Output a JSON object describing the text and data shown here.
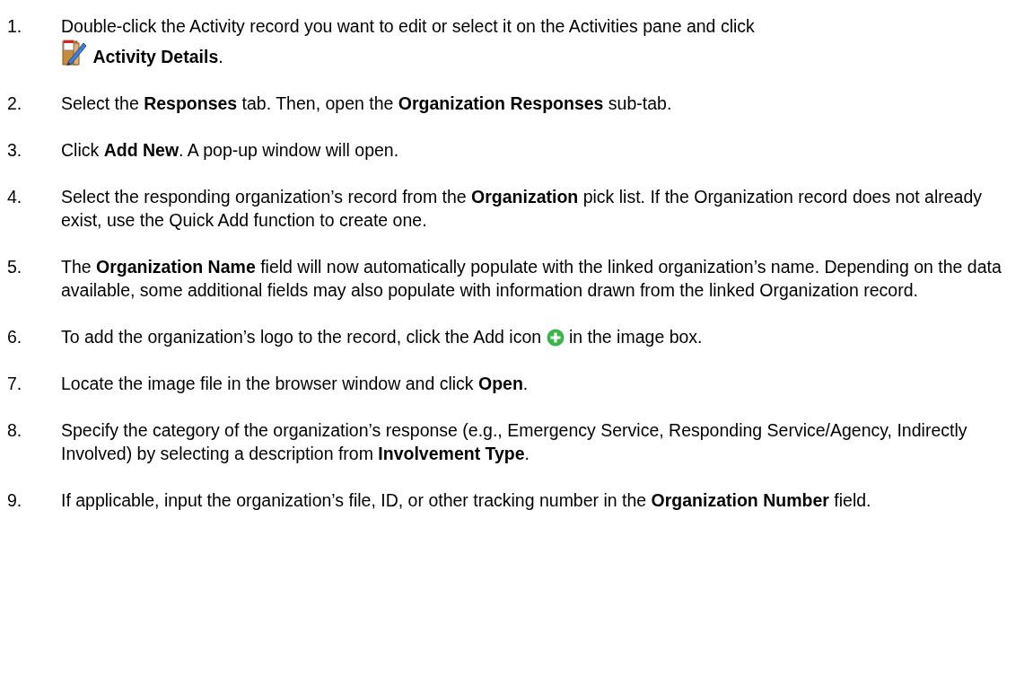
{
  "steps": [
    {
      "number": "1.",
      "kind": "details_icon",
      "before": "Double-click the Activity record you want to edit or select it on the Activities pane and click",
      "after": "**Activity Details**."
    },
    {
      "number": "2.",
      "kind": "plain",
      "before": "Select the **Responses** tab. Then, open the **Organization Responses** sub-tab."
    },
    {
      "number": "3.",
      "kind": "plain",
      "before": "Click **Add New**. A pop-up window will open."
    },
    {
      "number": "4.",
      "kind": "plain",
      "before": "Select the responding organization’s record from the **Organization** pick list. If the Organization record does not already exist, use the Quick Add function to create one."
    },
    {
      "number": "5.",
      "kind": "plain",
      "before": "The **Organization Name** field will now automatically populate with the linked organization’s name. Depending on the data available, some additional fields may also populate with information drawn from the linked Organization record."
    },
    {
      "number": "6.",
      "kind": "add_icon",
      "before": "To add the organization’s logo to the record, click the Add icon",
      "after": "in the image box."
    },
    {
      "number": "7.",
      "kind": "plain",
      "before": "Locate the image file in the browser window and click **Open**."
    },
    {
      "number": "8.",
      "kind": "plain",
      "before": "Specify the category of the organization’s response (e.g., Emergency Service, Responding Service/Agency, Indirectly Involved) by selecting a description from **Involvement Type**."
    },
    {
      "number": "9.",
      "kind": "plain",
      "before": "If applicable, input the organization’s file, ID, or other tracking number in the **Organization Number** field."
    }
  ]
}
